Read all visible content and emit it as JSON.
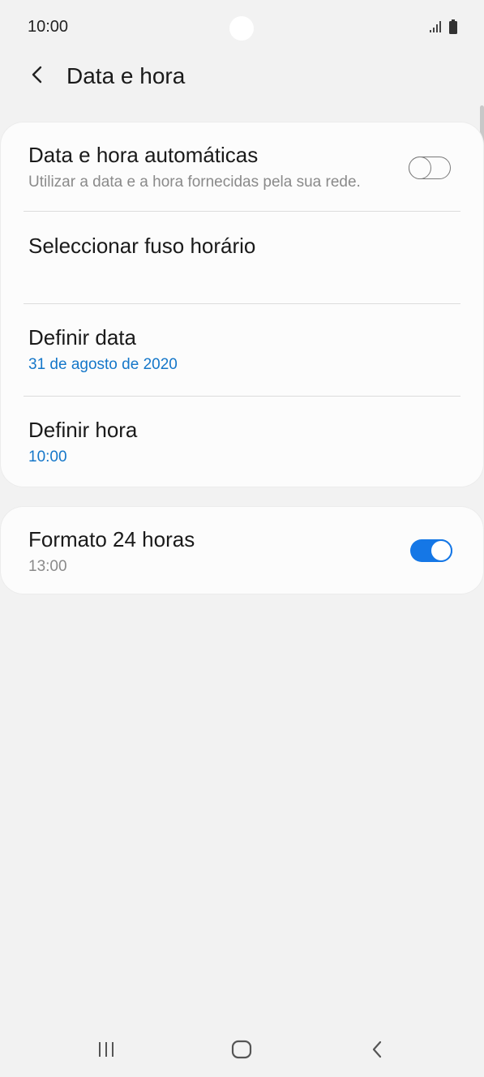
{
  "status_bar": {
    "time": "10:00",
    "icons": [
      "signal-icon",
      "battery-icon"
    ]
  },
  "header": {
    "title": "Data e hora",
    "back_icon": "chevron-left-icon"
  },
  "settings": {
    "auto_datetime": {
      "title": "Data e hora automáticas",
      "subtitle": "Utilizar a data e a hora fornecidas pela sua rede.",
      "enabled": false
    },
    "timezone": {
      "title": "Seleccionar fuso horário"
    },
    "set_date": {
      "title": "Definir data",
      "value": "31 de agosto de 2020"
    },
    "set_time": {
      "title": "Definir hora",
      "value": "10:00"
    },
    "format_24h": {
      "title": "Formato 24 horas",
      "subtitle": "13:00",
      "enabled": true
    }
  },
  "colors": {
    "accent": "#1577e6",
    "link_text": "#1577c9",
    "background": "#f2f2f2",
    "card": "#fcfcfc"
  },
  "nav_bar": {
    "icons": [
      "recents-icon",
      "home-icon",
      "back-icon"
    ]
  }
}
